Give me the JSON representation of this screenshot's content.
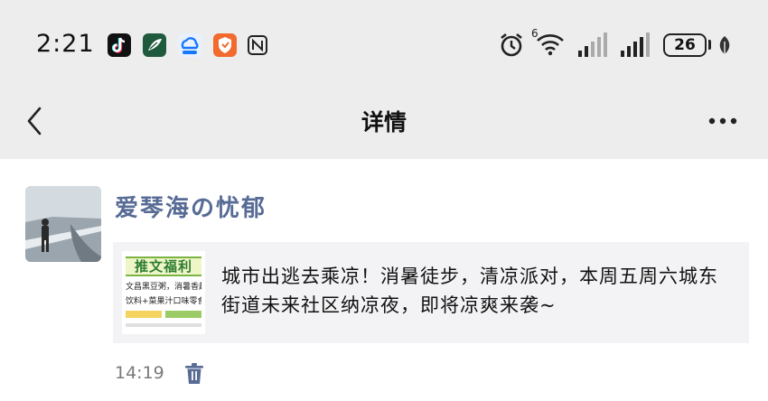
{
  "status_bar": {
    "time": "2:21",
    "app_icons": [
      "tiktok-icon",
      "feather-app-icon",
      "cloud-ai-icon",
      "shield-app-icon",
      "nfc-icon"
    ],
    "network_label": "6",
    "battery_level": "26",
    "icons": [
      "alarm-icon",
      "wifi-icon",
      "signal-icon",
      "signal-icon",
      "battery-icon",
      "leaf-icon"
    ]
  },
  "nav": {
    "title": "详情",
    "back_icon": "chevron-left-icon",
    "more_icon": "more-dots-icon"
  },
  "post": {
    "username": "爱琴海の忧郁",
    "avatar_icon": "avatar-photo",
    "card": {
      "thumbnail_banner": "推文福利",
      "thumbnail_lines": [
        "文昌黑豆粥，消暑香越",
        "饮料+菜果汁口味零食"
      ],
      "text": "城市出逃去乘凉！消暑徒步，清凉派对，本周五周六城东街道未来社区纳凉夜，即将凉爽来袭~"
    },
    "time": "14:19",
    "delete_icon": "trash-icon"
  },
  "colors": {
    "bar_bg": "#ededed",
    "username": "#576b95",
    "card_bg": "#f3f3f5",
    "meta_text": "#7a7a7a"
  }
}
